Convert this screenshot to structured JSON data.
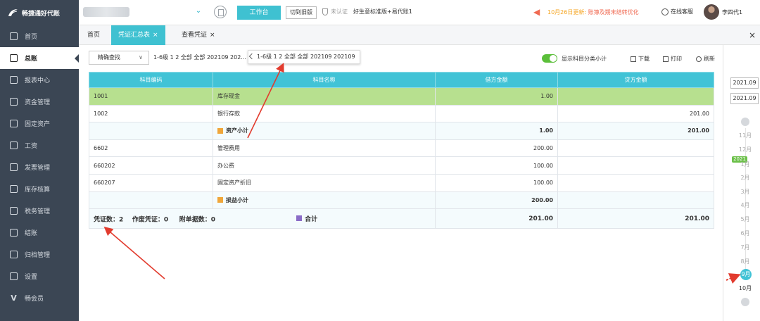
{
  "app": {
    "brand": "畅捷通好代账"
  },
  "header": {
    "workbench_label": "工作台",
    "old_version_label": "切到旧版",
    "auth_status": "未认证",
    "edition": "好生意标准版+易代账1",
    "notice_date": "10月26日更新:",
    "notice_text": "账簿及期末结转优化",
    "customer_service": "在线客服",
    "username": "李四代1"
  },
  "sidebar": {
    "items": [
      {
        "label": "首页",
        "icon": "home-icon"
      },
      {
        "label": "总账",
        "icon": "ledger-icon"
      },
      {
        "label": "报表中心",
        "icon": "chart-icon"
      },
      {
        "label": "资金管理",
        "icon": "money-icon"
      },
      {
        "label": "固定资产",
        "icon": "asset-icon"
      },
      {
        "label": "工资",
        "icon": "salary-icon"
      },
      {
        "label": "发票管理",
        "icon": "invoice-icon"
      },
      {
        "label": "库存核算",
        "icon": "inventory-icon"
      },
      {
        "label": "税务管理",
        "icon": "tax-icon"
      },
      {
        "label": "结账",
        "icon": "close-account-icon"
      },
      {
        "label": "归档管理",
        "icon": "archive-icon"
      },
      {
        "label": "设置",
        "icon": "settings-icon"
      },
      {
        "label": "畅会员",
        "icon": "vip-icon"
      }
    ]
  },
  "tabs": [
    {
      "label": "首页"
    },
    {
      "label": "凭证汇总表",
      "close": "×"
    },
    {
      "label": "查看凭证",
      "close": "×"
    }
  ],
  "tabs_close": "×",
  "toolbar": {
    "search_mode": "精确查找",
    "filter_summary": "1-6级 1 2 全部 全部 202109 202...",
    "filter_full": "1-6级 1 2 全部 全部 202109 202109",
    "toggle_label": "显示科目分类小计",
    "download": "下载",
    "print": "打印",
    "refresh": "刷新"
  },
  "table": {
    "headers": [
      "科目编码",
      "科目名称",
      "借方金额",
      "贷方金额"
    ],
    "rows": [
      {
        "code": "1001",
        "name": "库存现金",
        "debit": "1.00",
        "credit": ""
      },
      {
        "code": "1002",
        "name": "银行存款",
        "debit": "",
        "credit": "201.00"
      },
      {
        "subtotal_label": "资产小计",
        "debit": "1.00",
        "credit": "201.00"
      },
      {
        "code": "6602",
        "name": "管理费用",
        "debit": "200.00",
        "credit": ""
      },
      {
        "code": "660202",
        "name": "办公费",
        "debit": "100.00",
        "credit": ""
      },
      {
        "code": "660207",
        "name": "固定资产折旧",
        "debit": "100.00",
        "credit": ""
      },
      {
        "subtotal_label": "损益小计",
        "debit": "200.00",
        "credit": ""
      }
    ],
    "footer": {
      "voucher_count": "凭证数：2",
      "void_count": "作废凭证：0",
      "attach_count": "附单据数：0",
      "total_label": "合计",
      "debit": "201.00",
      "credit": "201.00"
    }
  },
  "period": {
    "start": "2021.09",
    "end": "2021.09",
    "year_tag": "2021",
    "months": [
      "11月",
      "12月",
      "1月",
      "2月",
      "3月",
      "4月",
      "5月",
      "6月",
      "7月",
      "8月",
      "9月",
      "10月"
    ],
    "selected": "9月"
  },
  "colors": {
    "accent": "#3fc1d1",
    "sidebar": "#3b4654",
    "highlight_row": "#b7e08f",
    "annotation": "#e23b2e"
  }
}
